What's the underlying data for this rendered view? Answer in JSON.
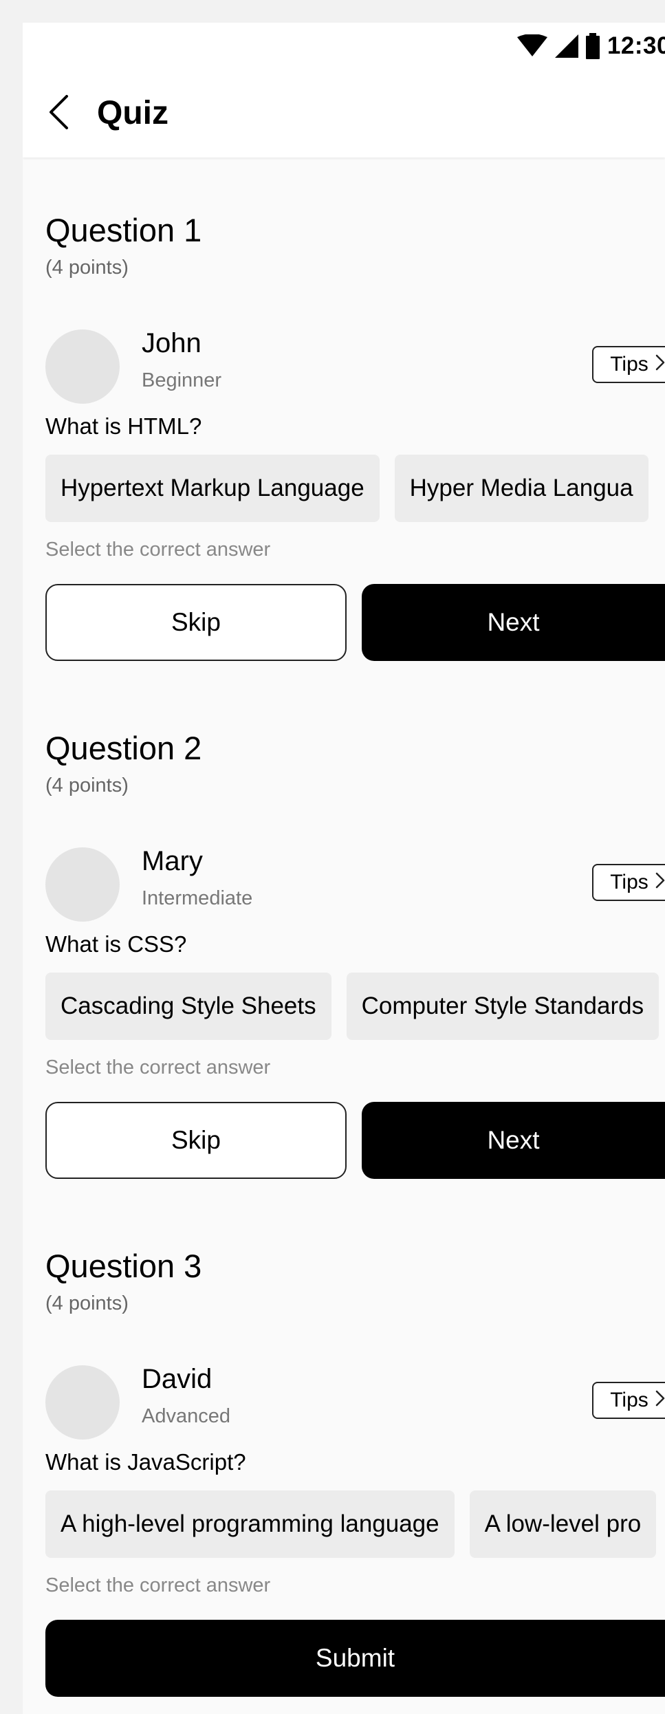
{
  "status_bar": {
    "time": "12:30",
    "icons": [
      "wifi-icon",
      "signal-icon",
      "battery-icon"
    ]
  },
  "header": {
    "back_icon": "chevron-left-icon",
    "title": "Quiz"
  },
  "questions": [
    {
      "title": "Question 1",
      "points": "(4 points)",
      "user": {
        "name": "John",
        "level": "Beginner"
      },
      "tips_label": "Tips",
      "question": "What is HTML?",
      "options": [
        "Hypertext Markup Language",
        "Hyper Media Langua"
      ],
      "hint": "Select the correct answer",
      "skip_label": "Skip",
      "next_label": "Next"
    },
    {
      "title": "Question 2",
      "points": "(4 points)",
      "user": {
        "name": "Mary",
        "level": "Intermediate"
      },
      "tips_label": "Tips",
      "question": "What is CSS?",
      "options": [
        "Cascading Style Sheets",
        "Computer Style Standards"
      ],
      "hint": "Select the correct answer",
      "skip_label": "Skip",
      "next_label": "Next"
    },
    {
      "title": "Question 3",
      "points": "(4 points)",
      "user": {
        "name": "David",
        "level": "Advanced"
      },
      "tips_label": "Tips",
      "question": "What is JavaScript?",
      "options": [
        "A high-level programming language",
        "A low-level pro"
      ],
      "hint": "Select the correct answer",
      "submit_label": "Submit"
    }
  ],
  "colors": {
    "primary": "#000000",
    "option_bg": "#ececec",
    "avatar_bg": "#e4e4e4",
    "page_bg": "#fafafa"
  }
}
